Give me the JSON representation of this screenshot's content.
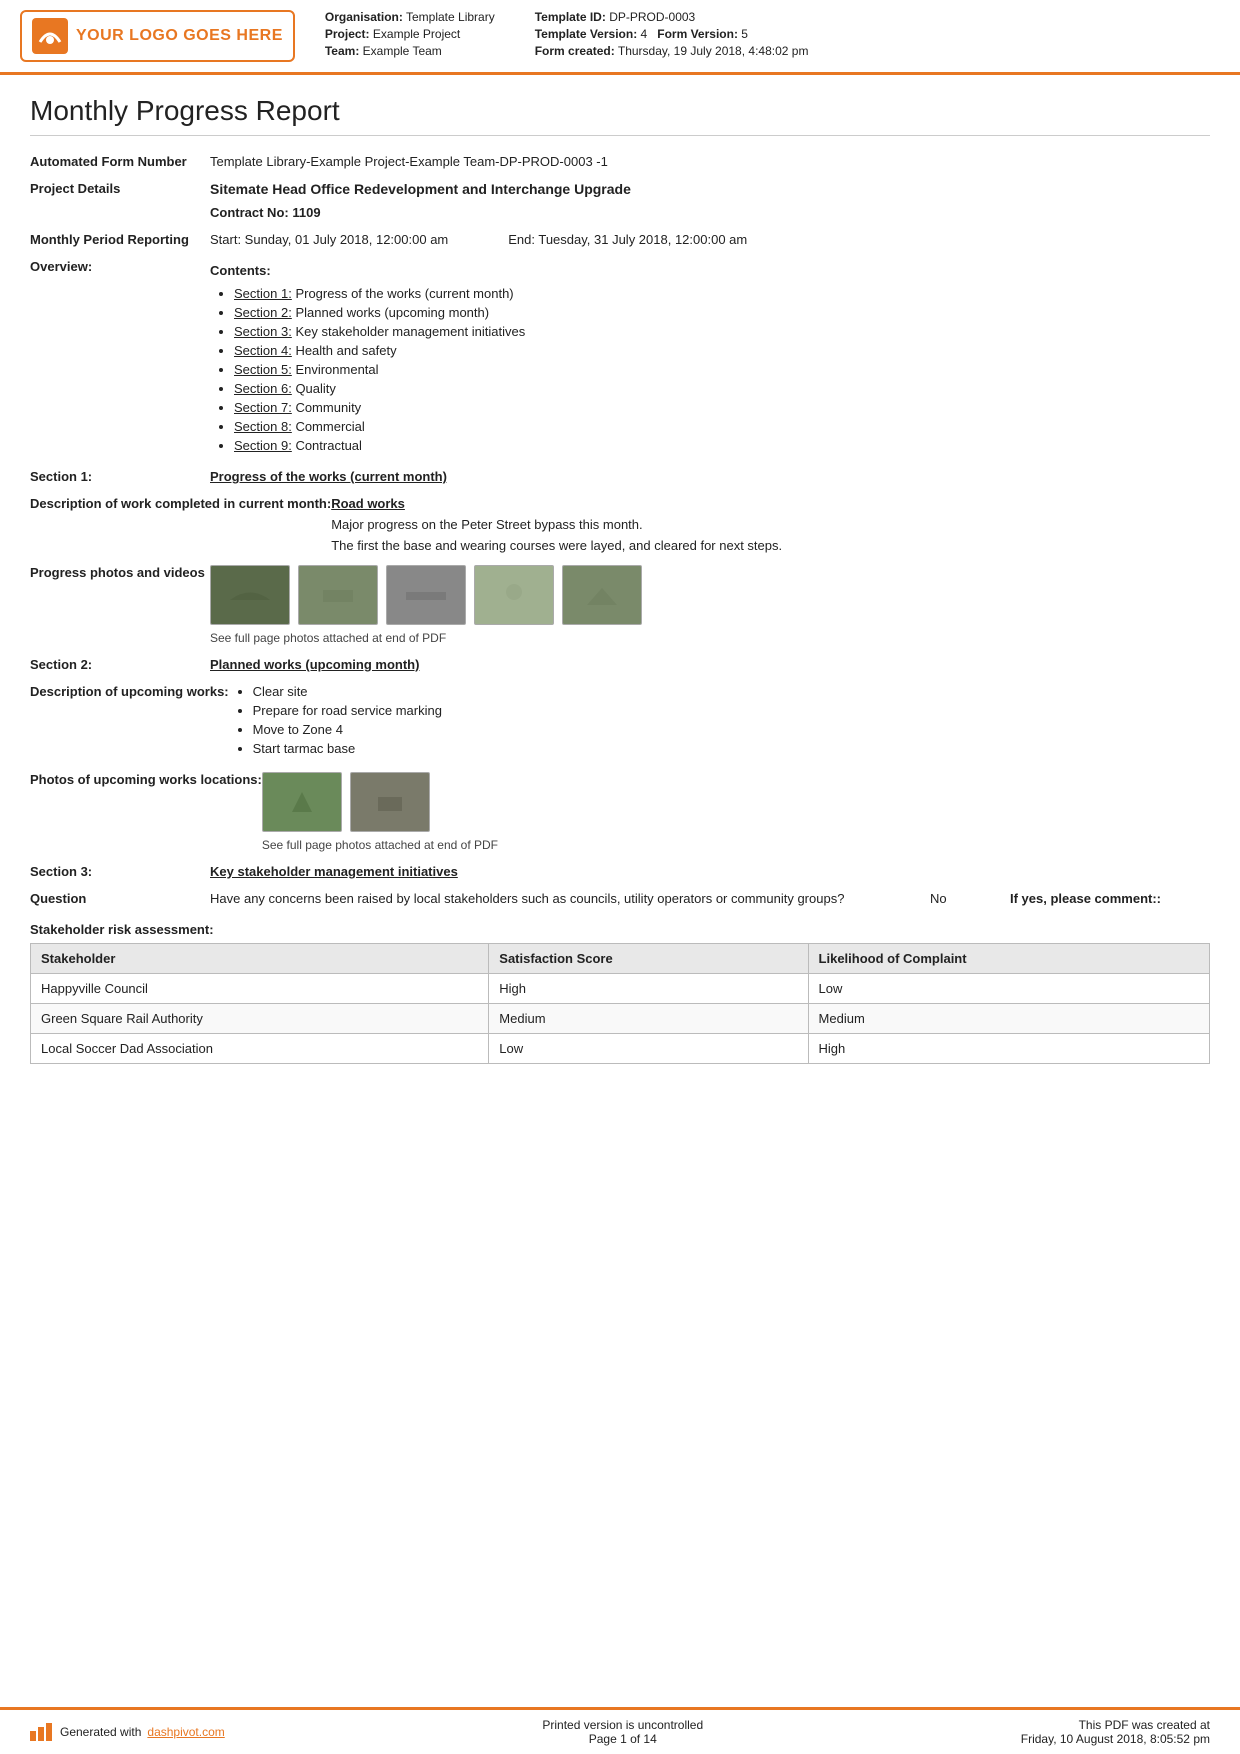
{
  "header": {
    "logo_text": "YOUR LOGO GOES HERE",
    "org_label": "Organisation:",
    "org_value": "Template Library",
    "project_label": "Project:",
    "project_value": "Example Project",
    "team_label": "Team:",
    "team_value": "Example Team",
    "template_id_label": "Template ID:",
    "template_id_value": "DP-PROD-0003",
    "template_version_label": "Template Version:",
    "template_version_value": "4",
    "form_version_label": "Form Version:",
    "form_version_value": "5",
    "form_created_label": "Form created:",
    "form_created_value": "Thursday, 19 July 2018, 4:48:02 pm"
  },
  "report": {
    "title": "Monthly Progress Report",
    "automated_form_number_label": "Automated Form Number",
    "automated_form_number_value": "Template Library-Example Project-Example Team-DP-PROD-0003   -1",
    "project_details_label": "Project Details",
    "project_details_name": "Sitemate Head Office Redevelopment and Interchange Upgrade",
    "contract_label": "Contract No:",
    "contract_value": "1109",
    "monthly_period_label": "Monthly Period Reporting",
    "period_start": "Start: Sunday, 01 July 2018, 12:00:00 am",
    "period_end": "End: Tuesday, 31 July 2018, 12:00:00 am"
  },
  "overview": {
    "label": "Overview:",
    "contents_title": "Contents:",
    "items": [
      {
        "section": "Section 1:",
        "desc": " Progress of the works (current month)"
      },
      {
        "section": "Section 2:",
        "desc": " Planned works (upcoming month)"
      },
      {
        "section": "Section 3:",
        "desc": " Key stakeholder management initiatives"
      },
      {
        "section": "Section 4:",
        "desc": " Health and safety"
      },
      {
        "section": "Section 5:",
        "desc": " Environmental"
      },
      {
        "section": "Section 6:",
        "desc": " Quality"
      },
      {
        "section": "Section 7:",
        "desc": " Community"
      },
      {
        "section": "Section 8:",
        "desc": " Commercial"
      },
      {
        "section": "Section 9:",
        "desc": " Contractual"
      }
    ]
  },
  "section1": {
    "label": "Section 1:",
    "heading": "Progress of the works (current month)",
    "description_label": "Description of work completed in current month:",
    "work_title": "Road works",
    "work_desc1": "Major progress on the Peter Street bypass this month.",
    "work_desc2": "The first the base and wearing courses were layed, and cleared for next steps.",
    "photos_label": "Progress photos and videos",
    "photo_caption": "See full page photos attached at end of PDF"
  },
  "section2": {
    "label": "Section 2:",
    "heading": "Planned works (upcoming month)",
    "description_label": "Description of upcoming works:",
    "works_items": [
      "Clear site",
      "Prepare for road service marking",
      "Move to Zone 4",
      "Start tarmac base"
    ],
    "photos_label": "Photos of upcoming works locations:",
    "photo_caption": "See full page photos attached at end of PDF"
  },
  "section3": {
    "label": "Section 3:",
    "heading": "Key stakeholder management initiatives",
    "question_label": "Question",
    "question_text": "Have any concerns been raised by local stakeholders such as councils, utility operators or community groups?",
    "question_answer": "No",
    "question_comment_label": "If yes, please comment::",
    "stakeholder_label": "Stakeholder risk assessment:",
    "table_headers": [
      "Stakeholder",
      "Satisfaction Score",
      "Likelihood of Complaint"
    ],
    "table_rows": [
      [
        "Happyville Council",
        "High",
        "Low"
      ],
      [
        "Green Square Rail Authority",
        "Medium",
        "Medium"
      ],
      [
        "Local Soccer Dad Association",
        "Low",
        "High"
      ]
    ]
  },
  "footer": {
    "generated_text": "Generated with ",
    "link_text": "dashpivot.com",
    "center_line1": "Printed version is uncontrolled",
    "center_line2": "Page 1 of 14",
    "right_line1": "This PDF was created at",
    "right_line2": "Friday, 10 August 2018, 8:05:52 pm"
  }
}
